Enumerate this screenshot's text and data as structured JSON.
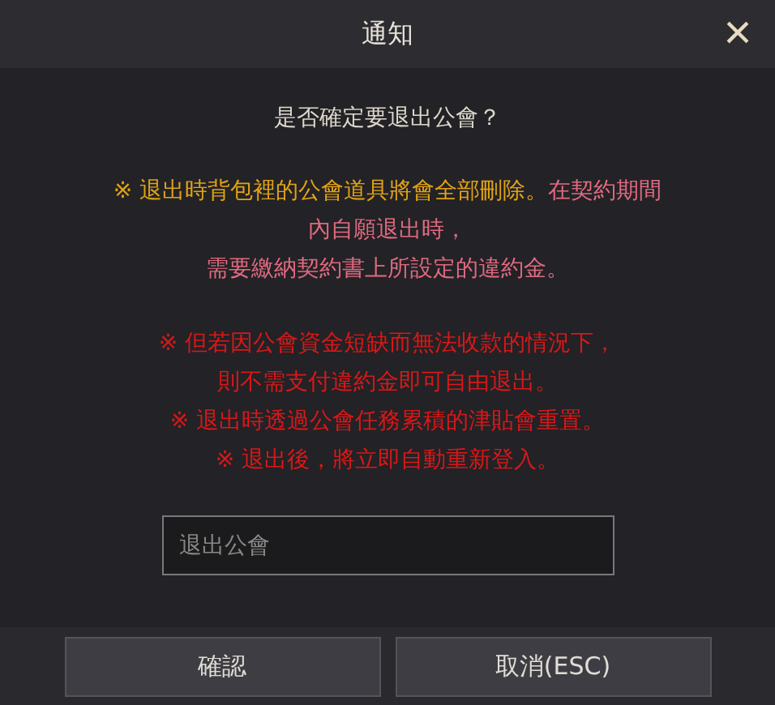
{
  "dialog": {
    "title": "通知",
    "close": "×"
  },
  "question": "是否確定要退出公會？",
  "warning": {
    "lines": [
      [
        {
          "text": "※ 退出時背包裡的公會道具將會全部刪除。",
          "color": "#e0a316"
        },
        {
          "text": "在契約期間",
          "color": "#e06a80"
        }
      ],
      [
        {
          "text": "內自願退出時，",
          "color": "#e06a80"
        }
      ],
      [
        {
          "text": "需要繳納契約書上所設定的違約金。",
          "color": "#e06a80"
        }
      ]
    ]
  },
  "notes": [
    {
      "lines": [
        "※ 但若因公會資金短缺而無法收款的情況下，",
        "則不需支付違約金即可自由退出。"
      ]
    },
    {
      "lines": [
        "※ 退出時透過公會任務累積的津貼會重置。"
      ]
    },
    {
      "lines": [
        "※ 退出後，將立即自動重新登入。"
      ]
    }
  ],
  "confirm_field": {
    "placeholder": "退出公會"
  },
  "buttons": [
    {
      "label": "確認"
    },
    {
      "label": "取消(ESC)"
    }
  ]
}
